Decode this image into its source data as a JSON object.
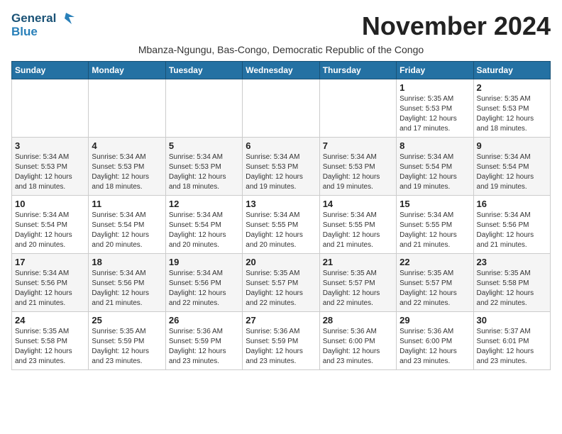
{
  "logo": {
    "line1": "General",
    "line2": "Blue"
  },
  "title": "November 2024",
  "subtitle": "Mbanza-Ngungu, Bas-Congo, Democratic Republic of the Congo",
  "days_of_week": [
    "Sunday",
    "Monday",
    "Tuesday",
    "Wednesday",
    "Thursday",
    "Friday",
    "Saturday"
  ],
  "weeks": [
    [
      {
        "day": "",
        "info": ""
      },
      {
        "day": "",
        "info": ""
      },
      {
        "day": "",
        "info": ""
      },
      {
        "day": "",
        "info": ""
      },
      {
        "day": "",
        "info": ""
      },
      {
        "day": "1",
        "info": "Sunrise: 5:35 AM\nSunset: 5:53 PM\nDaylight: 12 hours\nand 17 minutes."
      },
      {
        "day": "2",
        "info": "Sunrise: 5:35 AM\nSunset: 5:53 PM\nDaylight: 12 hours\nand 18 minutes."
      }
    ],
    [
      {
        "day": "3",
        "info": "Sunrise: 5:34 AM\nSunset: 5:53 PM\nDaylight: 12 hours\nand 18 minutes."
      },
      {
        "day": "4",
        "info": "Sunrise: 5:34 AM\nSunset: 5:53 PM\nDaylight: 12 hours\nand 18 minutes."
      },
      {
        "day": "5",
        "info": "Sunrise: 5:34 AM\nSunset: 5:53 PM\nDaylight: 12 hours\nand 18 minutes."
      },
      {
        "day": "6",
        "info": "Sunrise: 5:34 AM\nSunset: 5:53 PM\nDaylight: 12 hours\nand 19 minutes."
      },
      {
        "day": "7",
        "info": "Sunrise: 5:34 AM\nSunset: 5:53 PM\nDaylight: 12 hours\nand 19 minutes."
      },
      {
        "day": "8",
        "info": "Sunrise: 5:34 AM\nSunset: 5:54 PM\nDaylight: 12 hours\nand 19 minutes."
      },
      {
        "day": "9",
        "info": "Sunrise: 5:34 AM\nSunset: 5:54 PM\nDaylight: 12 hours\nand 19 minutes."
      }
    ],
    [
      {
        "day": "10",
        "info": "Sunrise: 5:34 AM\nSunset: 5:54 PM\nDaylight: 12 hours\nand 20 minutes."
      },
      {
        "day": "11",
        "info": "Sunrise: 5:34 AM\nSunset: 5:54 PM\nDaylight: 12 hours\nand 20 minutes."
      },
      {
        "day": "12",
        "info": "Sunrise: 5:34 AM\nSunset: 5:54 PM\nDaylight: 12 hours\nand 20 minutes."
      },
      {
        "day": "13",
        "info": "Sunrise: 5:34 AM\nSunset: 5:55 PM\nDaylight: 12 hours\nand 20 minutes."
      },
      {
        "day": "14",
        "info": "Sunrise: 5:34 AM\nSunset: 5:55 PM\nDaylight: 12 hours\nand 21 minutes."
      },
      {
        "day": "15",
        "info": "Sunrise: 5:34 AM\nSunset: 5:55 PM\nDaylight: 12 hours\nand 21 minutes."
      },
      {
        "day": "16",
        "info": "Sunrise: 5:34 AM\nSunset: 5:56 PM\nDaylight: 12 hours\nand 21 minutes."
      }
    ],
    [
      {
        "day": "17",
        "info": "Sunrise: 5:34 AM\nSunset: 5:56 PM\nDaylight: 12 hours\nand 21 minutes."
      },
      {
        "day": "18",
        "info": "Sunrise: 5:34 AM\nSunset: 5:56 PM\nDaylight: 12 hours\nand 21 minutes."
      },
      {
        "day": "19",
        "info": "Sunrise: 5:34 AM\nSunset: 5:56 PM\nDaylight: 12 hours\nand 22 minutes."
      },
      {
        "day": "20",
        "info": "Sunrise: 5:35 AM\nSunset: 5:57 PM\nDaylight: 12 hours\nand 22 minutes."
      },
      {
        "day": "21",
        "info": "Sunrise: 5:35 AM\nSunset: 5:57 PM\nDaylight: 12 hours\nand 22 minutes."
      },
      {
        "day": "22",
        "info": "Sunrise: 5:35 AM\nSunset: 5:57 PM\nDaylight: 12 hours\nand 22 minutes."
      },
      {
        "day": "23",
        "info": "Sunrise: 5:35 AM\nSunset: 5:58 PM\nDaylight: 12 hours\nand 22 minutes."
      }
    ],
    [
      {
        "day": "24",
        "info": "Sunrise: 5:35 AM\nSunset: 5:58 PM\nDaylight: 12 hours\nand 23 minutes."
      },
      {
        "day": "25",
        "info": "Sunrise: 5:35 AM\nSunset: 5:59 PM\nDaylight: 12 hours\nand 23 minutes."
      },
      {
        "day": "26",
        "info": "Sunrise: 5:36 AM\nSunset: 5:59 PM\nDaylight: 12 hours\nand 23 minutes."
      },
      {
        "day": "27",
        "info": "Sunrise: 5:36 AM\nSunset: 5:59 PM\nDaylight: 12 hours\nand 23 minutes."
      },
      {
        "day": "28",
        "info": "Sunrise: 5:36 AM\nSunset: 6:00 PM\nDaylight: 12 hours\nand 23 minutes."
      },
      {
        "day": "29",
        "info": "Sunrise: 5:36 AM\nSunset: 6:00 PM\nDaylight: 12 hours\nand 23 minutes."
      },
      {
        "day": "30",
        "info": "Sunrise: 5:37 AM\nSunset: 6:01 PM\nDaylight: 12 hours\nand 23 minutes."
      }
    ]
  ]
}
